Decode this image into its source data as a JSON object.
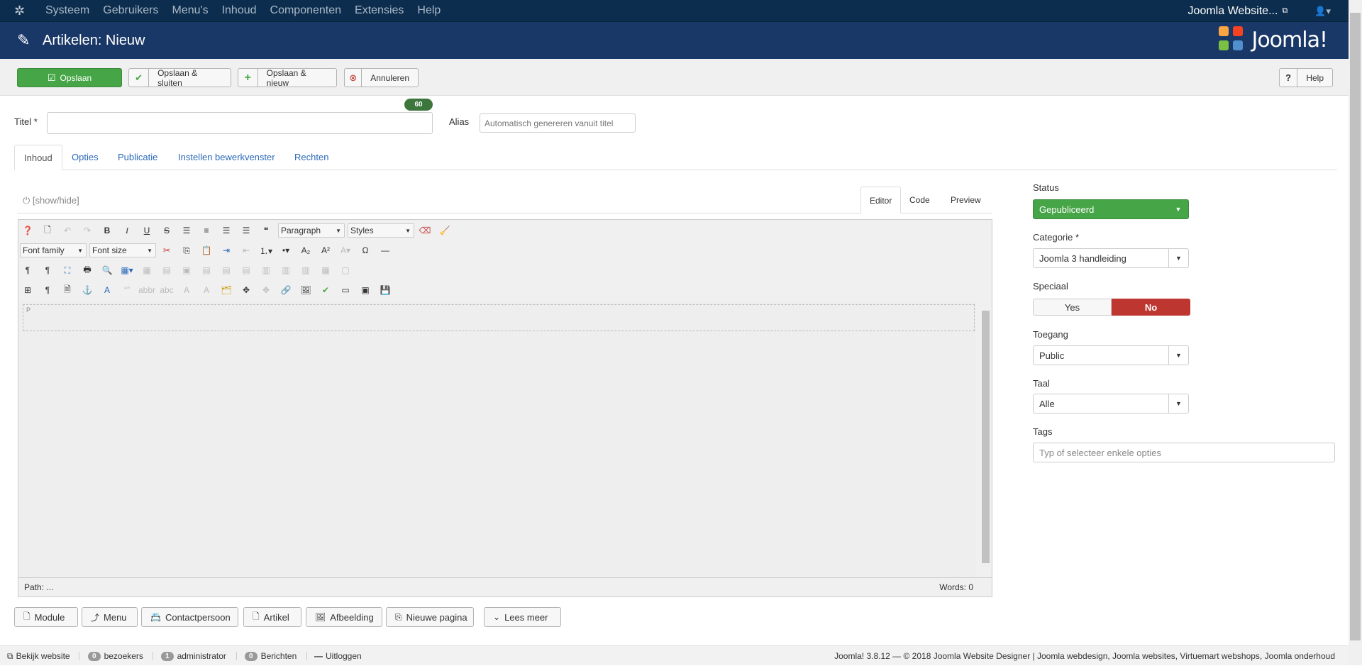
{
  "navbar": {
    "menu": [
      "Systeem",
      "Gebruikers",
      "Menu's",
      "Inhoud",
      "Componenten",
      "Extensies",
      "Help"
    ],
    "site_link": "Joomla Website..."
  },
  "header": {
    "title": "Artikelen: Nieuw",
    "brand": "Joomla!"
  },
  "toolbar": {
    "save": "Opslaan",
    "save_close": "Opslaan & sluiten",
    "save_new": "Opslaan & nieuw",
    "cancel": "Annuleren",
    "help": "Help"
  },
  "form": {
    "title_label": "Titel *",
    "title_value": "",
    "title_counter": "60",
    "alias_label": "Alias",
    "alias_placeholder": "Automatisch genereren vanuit titel"
  },
  "tabs": [
    "Inhoud",
    "Opties",
    "Publicatie",
    "Instellen bewerkvenster",
    "Rechten"
  ],
  "editor": {
    "toggle_label": "[show/hide]",
    "tabs": [
      "Editor",
      "Code",
      "Preview"
    ],
    "format_select": "Paragraph",
    "styles_select": "Styles",
    "font_family": "Font family",
    "font_size": "Font size",
    "block_marker": "P",
    "path": "Path: ...",
    "words": "Words: 0"
  },
  "xtd_buttons": [
    "Module",
    "Menu",
    "Contactpersoon",
    "Artikel",
    "Afbeelding",
    "Nieuwe pagina",
    "Lees meer"
  ],
  "sidebar": {
    "status_label": "Status",
    "status_value": "Gepubliceerd",
    "category_label": "Categorie *",
    "category_value": "Joomla 3 handleiding",
    "featured_label": "Speciaal",
    "featured_yes": "Yes",
    "featured_no": "No",
    "access_label": "Toegang",
    "access_value": "Public",
    "language_label": "Taal",
    "language_value": "Alle",
    "tags_label": "Tags",
    "tags_placeholder": "Typ of selecteer enkele opties"
  },
  "footer": {
    "view_site": "Bekijk website",
    "visitors_count": "0",
    "visitors_label": "bezoekers",
    "admins_count": "1",
    "admins_label": "administrator",
    "messages_count": "0",
    "messages_label": "Berichten",
    "logout": "Uitloggen",
    "copyright": "Joomla! 3.8.12 — © 2018 Joomla Website Designer | Joomla webdesign, Joomla websites, Virtuemart webshops, Joomla onderhoud"
  },
  "colors": {
    "navbar": "#0d2d4e",
    "header": "#1a3867",
    "success": "#46a546",
    "danger": "#bd362f",
    "link": "#2a69b8"
  }
}
